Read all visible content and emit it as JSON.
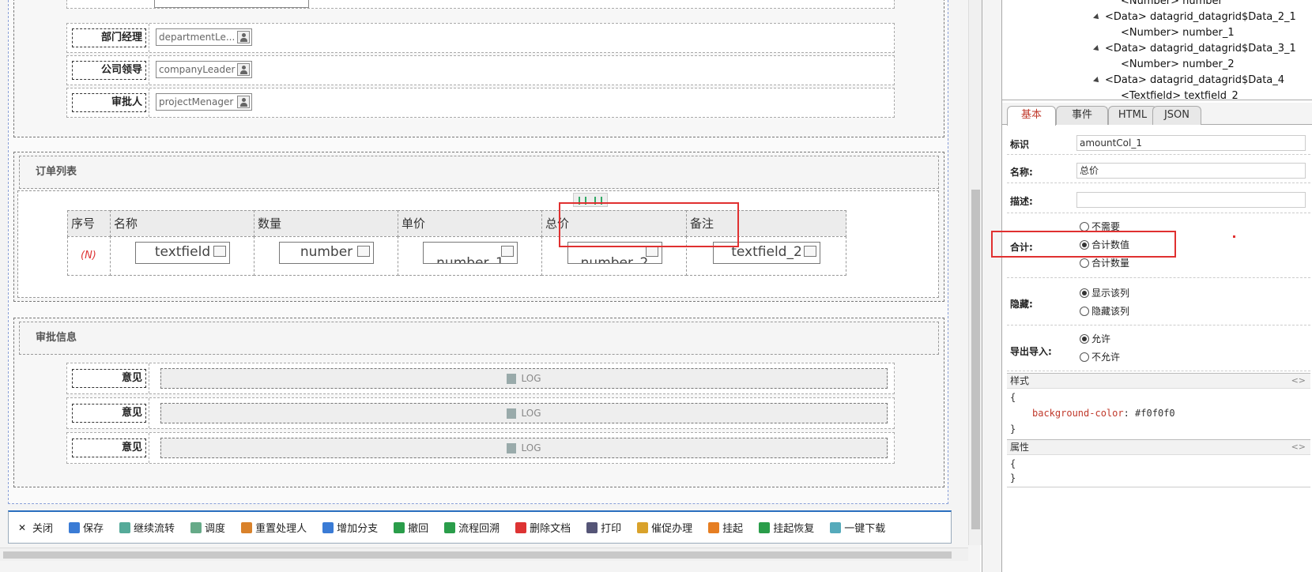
{
  "approvers": {
    "rows": [
      {
        "label": "部门经理",
        "value": "departmentLe..."
      },
      {
        "label": "公司领导",
        "value": "companyLeader"
      },
      {
        "label": "审批人",
        "value": "projectMenager"
      }
    ]
  },
  "order_section": {
    "title": "订单列表",
    "headers": [
      "序号",
      "名称",
      "数量",
      "单价",
      "总价",
      "备注"
    ],
    "row": {
      "index": "(N)",
      "fields": [
        "textfield",
        "number",
        "number_1",
        "number_2",
        "textfield_2"
      ]
    }
  },
  "approval_section": {
    "title": "审批信息",
    "rows": [
      {
        "label": "意见",
        "log": "LOG"
      },
      {
        "label": "意见",
        "log": "LOG"
      },
      {
        "label": "意见",
        "log": "LOG"
      }
    ]
  },
  "toolbar": {
    "items": [
      {
        "label": "关闭",
        "icon": "close-icon",
        "color": "#444"
      },
      {
        "label": "保存",
        "icon": "save-icon",
        "color": "#3a7bd5"
      },
      {
        "label": "继续流转",
        "icon": "forward-icon",
        "color": "#5a9"
      },
      {
        "label": "调度",
        "icon": "dispatch-icon",
        "color": "#6a8"
      },
      {
        "label": "重置处理人",
        "icon": "reset-handler-icon",
        "color": "#d9822b"
      },
      {
        "label": "增加分支",
        "icon": "branch-icon",
        "color": "#3a7bd5"
      },
      {
        "label": "撤回",
        "icon": "undo-icon",
        "color": "#2a9d4a"
      },
      {
        "label": "流程回溯",
        "icon": "trace-icon",
        "color": "#2a9d4a"
      },
      {
        "label": "删除文档",
        "icon": "delete-icon",
        "color": "#d33"
      },
      {
        "label": "打印",
        "icon": "print-icon",
        "color": "#557"
      },
      {
        "label": "催促办理",
        "icon": "urge-icon",
        "color": "#d9a22b"
      },
      {
        "label": "挂起",
        "icon": "suspend-icon",
        "color": "#e67e22"
      },
      {
        "label": "挂起恢复",
        "icon": "resume-icon",
        "color": "#2a9d4a"
      },
      {
        "label": "一键下载",
        "icon": "download-icon",
        "color": "#5ab"
      }
    ]
  },
  "tree": {
    "nodes": [
      {
        "text": "<Number> number",
        "expand": false,
        "indent": 1
      },
      {
        "text": "<Data> datagrid_datagrid$Data_2_1",
        "expand": true,
        "indent": 0
      },
      {
        "text": "<Number> number_1",
        "expand": false,
        "indent": 1
      },
      {
        "text": "<Data> datagrid_datagrid$Data_3_1",
        "expand": true,
        "indent": 0
      },
      {
        "text": "<Number> number_2",
        "expand": false,
        "indent": 1
      },
      {
        "text": "<Data> datagrid_datagrid$Data_4",
        "expand": true,
        "indent": 0
      },
      {
        "text": "<Textfield> textfield_2",
        "expand": false,
        "indent": 1
      }
    ]
  },
  "tabs": [
    {
      "label": "基本",
      "active": true
    },
    {
      "label": "事件",
      "active": false
    },
    {
      "label": "HTML",
      "active": false
    },
    {
      "label": "JSON",
      "active": false
    }
  ],
  "props": {
    "id_label": "标识",
    "id_value": "amountCol_1",
    "name_label": "名称:",
    "name_value": "总价",
    "desc_label": "描述:",
    "desc_value": "",
    "sum_label": "合计:",
    "sum_options": [
      "不需要",
      "合计数值",
      "合计数量"
    ],
    "sum_selected": 1,
    "hide_label": "隐藏:",
    "hide_options": [
      "显示该列",
      "隐藏该列"
    ],
    "hide_selected": 0,
    "export_label": "导出导入:",
    "export_options": [
      "允许",
      "不允许"
    ],
    "export_selected": 0
  },
  "style_box": {
    "title": "样式",
    "toggle": "<>",
    "open": "{",
    "prop": "background-color",
    "value": "#f0f0f0",
    "close": "}",
    "prop_color": "#c0392b"
  },
  "attr_box": {
    "title": "属性",
    "toggle": "<>",
    "open": "{",
    "close": "}"
  }
}
